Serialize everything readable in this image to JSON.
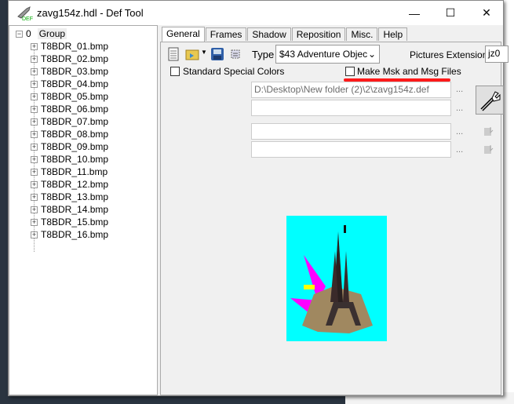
{
  "window": {
    "title": "zavg154z.hdl - Def Tool",
    "minimize": "—",
    "maximize": "☐",
    "close": "✕"
  },
  "tree": {
    "root_index": "0",
    "root_label": "Group",
    "items": [
      "T8BDR_01.bmp",
      "T8BDR_02.bmp",
      "T8BDR_03.bmp",
      "T8BDR_04.bmp",
      "T8BDR_05.bmp",
      "T8BDR_06.bmp",
      "T8BDR_07.bmp",
      "T8BDR_08.bmp",
      "T8BDR_09.bmp",
      "T8BDR_10.bmp",
      "T8BDR_11.bmp",
      "T8BDR_12.bmp",
      "T8BDR_13.bmp",
      "T8BDR_14.bmp",
      "T8BDR_15.bmp",
      "T8BDR_16.bmp"
    ]
  },
  "tabs": [
    "General",
    "Frames",
    "Shadow",
    "Reposition",
    "Misc.",
    "Help"
  ],
  "general": {
    "type_label": "Type",
    "type_value": "$43  Adventure Objec",
    "ext_label": "Pictures Extension",
    "ext_value": "jz0",
    "std_colors_label": "Standard Special Colors",
    "std_colors_checked": false,
    "msk_label": "Make Msk and Msg Files",
    "msk_checked": false,
    "def_path": "D:\\Desktop\\New folder (2)\\2\\zavg154z.def",
    "browse": "...",
    "annotation_color": "#ff0000",
    "preview_bg": "#00ffff"
  }
}
